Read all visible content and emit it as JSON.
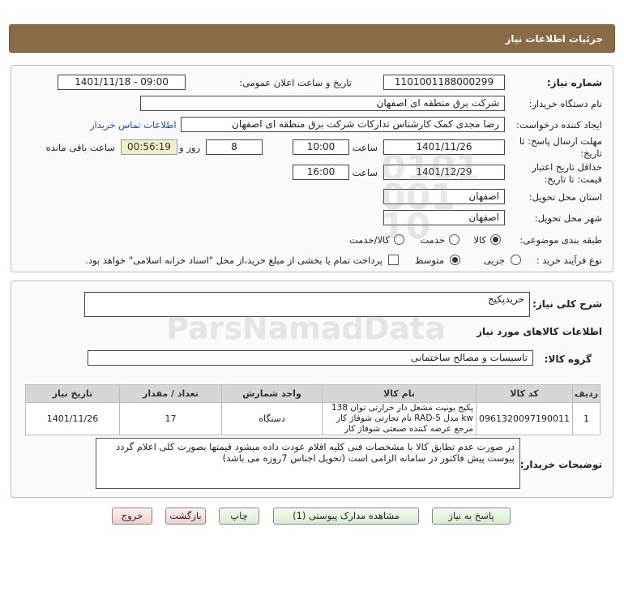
{
  "header": {
    "title": "جزئیات اطلاعات نیاز"
  },
  "form": {
    "need_number_label": "شماره نیاز:",
    "need_number": "1101001188000299",
    "announce_label": "تاریخ و ساعت اعلان عمومی:",
    "announce_value": "1401/11/18 - 09:00",
    "buyer_org_label": "نام دستگاه خریدار:",
    "buyer_org": "شرکت برق منطقه ای اصفهان",
    "creator_label": "ایجاد کننده درخواست:",
    "creator": "رضا  مجدی کمک کارشناس تدارکات شرکت برق منطقه ای اصفهان",
    "contact_link": "اطلاعات تماس خریدار",
    "deadline_label_1": "مهلت ارسال پاسخ: تا",
    "deadline_label_2": "تاریخ:",
    "deadline_date": "1401/11/26",
    "time_label": "ساعت",
    "deadline_time": "10:00",
    "days": "8",
    "days_label": "روز و",
    "remaining_time": "00:56:19",
    "remaining_label": "ساعت باقی مانده",
    "validity_label_1": "حداقل تاریخ اعتبار",
    "validity_label_2": "قیمت: تا تاریخ:",
    "validity_date": "1401/12/29",
    "validity_time": "16:00",
    "province_label": "استان محل تحویل:",
    "province": "اصفهان",
    "city_label": "شهر محل تحویل:",
    "city": "اصفهان",
    "category_label": "طبقه بندی موضوعی:",
    "category_options": [
      "کالا",
      "خدمت",
      "کالا/خدمت"
    ],
    "process_label": "نوع فرآیند خرید :",
    "process_options": [
      "جزیی",
      "متوسط"
    ],
    "payment_note": "پرداخت تمام یا بخشی از مبلغ خرید،از محل \"اسناد خزانه اسلامی\" خواهد بود."
  },
  "details": {
    "summary_label": "شرح کلی نیاز:",
    "summary": "خریدپکیج",
    "goods_info_label": "اطلاعات کالاهای مورد نیاز",
    "group_label": "گروه کالا:",
    "group": "تاسیسات و مصالح ساختمانی",
    "table": {
      "headers": [
        "ردیف",
        "کد کالا",
        "نام کالا",
        "واحد شمارش",
        "تعداد / مقدار",
        "تاریخ نیاز"
      ],
      "rows": [
        [
          "1",
          "0961320097190011",
          "پکیج یونیت مشعل دار حرارتی توان 138 kw مدل RAD-5 نام تجارتی شوفاژ کار مرجع عرضه کننده صنعتی شوفاژ کار",
          "دستگاه",
          "17",
          "1401/11/26"
        ]
      ]
    },
    "notes_label": "توضیحات خریدار:",
    "notes": "در صورت عدم تطابق کالا با مشخصات فنی کلیه اقلام عودت داده میشود قیمتها بصورت کلی اعلام گردد پیوست پیش فاکتور در سامانه الزامی است (تحویل اجناس 7روزه می باشد)"
  },
  "buttons": {
    "reply": "پاسخ به نیاز",
    "attachments": "مشاهده مدارک پیوستی (1)",
    "print": "چاپ",
    "back": "بازگشت",
    "exit": "خروج"
  },
  "watermark": {
    "brand": "ParsNamadData",
    "number": "0101 001 10"
  }
}
